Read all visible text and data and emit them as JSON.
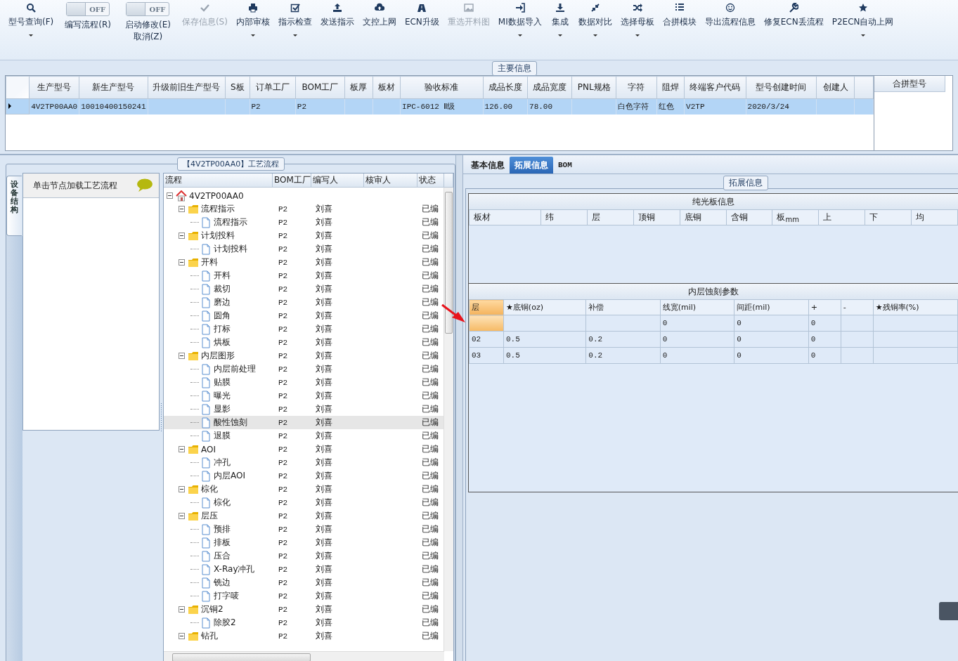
{
  "toolbar": [
    {
      "kind": "button",
      "label": "型号查询(F)",
      "dropdown": true,
      "disabled": false
    },
    {
      "kind": "toggle",
      "label": "编写流程(R)",
      "state": "OFF",
      "on": false
    },
    {
      "kind": "toggle",
      "label": "启动修改(E)\n取消(Z)",
      "state": "OFF",
      "on": false
    },
    {
      "kind": "button",
      "label": "保存信息(S)",
      "dropdown": false,
      "disabled": true
    },
    {
      "kind": "button",
      "label": "内部审核",
      "dropdown": true,
      "disabled": false
    },
    {
      "kind": "button",
      "label": "指示检查",
      "dropdown": true,
      "disabled": false
    },
    {
      "kind": "button",
      "label": "发送指示",
      "dropdown": false,
      "disabled": false
    },
    {
      "kind": "button",
      "label": "文控上网",
      "dropdown": false,
      "disabled": false
    },
    {
      "kind": "button",
      "label": "ECN升级",
      "dropdown": false,
      "disabled": false
    },
    {
      "kind": "button",
      "label": "重选开料图",
      "dropdown": false,
      "disabled": true
    },
    {
      "kind": "button",
      "label": "MI数据导入",
      "dropdown": true,
      "disabled": false
    },
    {
      "kind": "button",
      "label": "集成",
      "dropdown": true,
      "disabled": false
    },
    {
      "kind": "button",
      "label": "数据对比",
      "dropdown": true,
      "disabled": false
    },
    {
      "kind": "button",
      "label": "选择母板",
      "dropdown": true,
      "disabled": false
    },
    {
      "kind": "button",
      "label": "合拼模块",
      "dropdown": false,
      "disabled": false
    },
    {
      "kind": "button",
      "label": "导出流程信息",
      "dropdown": false,
      "disabled": false
    },
    {
      "kind": "button",
      "label": "修复ECN丢流程",
      "dropdown": false,
      "disabled": false
    },
    {
      "kind": "button",
      "label": "P2ECN自动上网",
      "dropdown": true,
      "disabled": false
    }
  ],
  "main_info": {
    "title": "主要信息",
    "columns": [
      "生产型号",
      "新生产型号",
      "升级前旧生产型号",
      "S板",
      "订单工厂",
      "BOM工厂",
      "板厚",
      "板材",
      "验收标准",
      "成品长度",
      "成品宽度",
      "PNL规格",
      "字符",
      "阻焊",
      "终端客户代码",
      "型号创建时间",
      "创建人"
    ],
    "rows": [
      {
        "selected": true,
        "cells": [
          "4V2TP00AA0",
          "10010400150241",
          "",
          "",
          "P2",
          "P2",
          "",
          "",
          "IPC-6012 Ⅱ级",
          "126.00",
          "78.00",
          "",
          "白色字符",
          "红色",
          "V2TP",
          "2020/3/24",
          ""
        ]
      }
    ],
    "side_columns": [
      "合拼型号"
    ]
  },
  "process": {
    "title": "【4V2TP00AA0】工艺流程",
    "side_tab": {
      "label": "设备结构",
      "selected": true
    },
    "hint": "单击节点加载工艺流程",
    "columns": [
      "流程",
      "BOM工厂",
      "编写人",
      "核审人",
      "状态"
    ],
    "tree": [
      {
        "kind": "root",
        "label": "4V2TP00AA0",
        "expanded": true,
        "selected": false,
        "children": [
          {
            "kind": "folder",
            "label": "流程指示",
            "bom": "P2",
            "writer": "刘喜",
            "status": "已编",
            "expanded": true,
            "selected": false,
            "children": [
              {
                "kind": "step",
                "label": "流程指示",
                "bom": "P2",
                "writer": "刘喜",
                "status": "已编",
                "selected": false
              }
            ]
          },
          {
            "kind": "folder",
            "label": "计划投料",
            "bom": "P2",
            "writer": "刘喜",
            "status": "已编",
            "expanded": true,
            "selected": false,
            "children": [
              {
                "kind": "step",
                "label": "计划投料",
                "bom": "P2",
                "writer": "刘喜",
                "status": "已编",
                "selected": false
              }
            ]
          },
          {
            "kind": "folder",
            "label": "开料",
            "bom": "P2",
            "writer": "刘喜",
            "status": "已编",
            "expanded": true,
            "selected": false,
            "children": [
              {
                "kind": "step",
                "label": "开料",
                "bom": "P2",
                "writer": "刘喜",
                "status": "已编",
                "selected": false
              },
              {
                "kind": "step",
                "label": "裁切",
                "bom": "P2",
                "writer": "刘喜",
                "status": "已编",
                "selected": false
              },
              {
                "kind": "step",
                "label": "磨边",
                "bom": "P2",
                "writer": "刘喜",
                "status": "已编",
                "selected": false
              },
              {
                "kind": "step",
                "label": "圆角",
                "bom": "P2",
                "writer": "刘喜",
                "status": "已编",
                "selected": false
              },
              {
                "kind": "step",
                "label": "打标",
                "bom": "P2",
                "writer": "刘喜",
                "status": "已编",
                "selected": false
              },
              {
                "kind": "step",
                "label": "烘板",
                "bom": "P2",
                "writer": "刘喜",
                "status": "已编",
                "selected": false
              }
            ]
          },
          {
            "kind": "folder",
            "label": "内层图形",
            "bom": "P2",
            "writer": "刘喜",
            "status": "已编",
            "expanded": true,
            "selected": false,
            "children": [
              {
                "kind": "step",
                "label": "内层前处理",
                "bom": "P2",
                "writer": "刘喜",
                "status": "已编",
                "selected": false
              },
              {
                "kind": "step",
                "label": "贴膜",
                "bom": "P2",
                "writer": "刘喜",
                "status": "已编",
                "selected": false
              },
              {
                "kind": "step",
                "label": "曝光",
                "bom": "P2",
                "writer": "刘喜",
                "status": "已编",
                "selected": false
              },
              {
                "kind": "step",
                "label": "显影",
                "bom": "P2",
                "writer": "刘喜",
                "status": "已编",
                "selected": false
              },
              {
                "kind": "step",
                "label": "酸性蚀刻",
                "bom": "P2",
                "writer": "刘喜",
                "status": "已编",
                "selected": true
              },
              {
                "kind": "step",
                "label": "退膜",
                "bom": "P2",
                "writer": "刘喜",
                "status": "已编",
                "selected": false
              }
            ]
          },
          {
            "kind": "folder",
            "label": "AOI",
            "bom": "P2",
            "writer": "刘喜",
            "status": "已编",
            "expanded": true,
            "selected": false,
            "children": [
              {
                "kind": "step",
                "label": "冲孔",
                "bom": "P2",
                "writer": "刘喜",
                "status": "已编",
                "selected": false
              },
              {
                "kind": "step",
                "label": "内层AOI",
                "bom": "P2",
                "writer": "刘喜",
                "status": "已编",
                "selected": false
              }
            ]
          },
          {
            "kind": "folder",
            "label": "棕化",
            "bom": "P2",
            "writer": "刘喜",
            "status": "已编",
            "expanded": true,
            "selected": false,
            "children": [
              {
                "kind": "step",
                "label": "棕化",
                "bom": "P2",
                "writer": "刘喜",
                "status": "已编",
                "selected": false
              }
            ]
          },
          {
            "kind": "folder",
            "label": "层压",
            "bom": "P2",
            "writer": "刘喜",
            "status": "已编",
            "expanded": true,
            "selected": false,
            "children": [
              {
                "kind": "step",
                "label": "预排",
                "bom": "P2",
                "writer": "刘喜",
                "status": "已编",
                "selected": false
              },
              {
                "kind": "step",
                "label": "排板",
                "bom": "P2",
                "writer": "刘喜",
                "status": "已编",
                "selected": false
              },
              {
                "kind": "step",
                "label": "压合",
                "bom": "P2",
                "writer": "刘喜",
                "status": "已编",
                "selected": false
              },
              {
                "kind": "step",
                "label": "X-Ray冲孔",
                "bom": "P2",
                "writer": "刘喜",
                "status": "已编",
                "selected": false
              },
              {
                "kind": "step",
                "label": "铣边",
                "bom": "P2",
                "writer": "刘喜",
                "status": "已编",
                "selected": false
              },
              {
                "kind": "step",
                "label": "打字唛",
                "bom": "P2",
                "writer": "刘喜",
                "status": "已编",
                "selected": false
              }
            ]
          },
          {
            "kind": "folder",
            "label": "沉铜2",
            "bom": "P2",
            "writer": "刘喜",
            "status": "已编",
            "expanded": true,
            "selected": false,
            "children": [
              {
                "kind": "step",
                "label": "除胶2",
                "bom": "P2",
                "writer": "刘喜",
                "status": "已编",
                "selected": false
              }
            ]
          },
          {
            "kind": "folder",
            "label": "钻孔",
            "bom": "P2",
            "writer": "刘喜",
            "status": "已编",
            "expanded": true,
            "selected": false
          }
        ]
      }
    ]
  },
  "detail": {
    "tabs": [
      {
        "label": "基本信息",
        "selected": false
      },
      {
        "label": "拓展信息",
        "selected": true
      },
      {
        "label": "BOM",
        "selected": false
      }
    ],
    "group_title": "拓展信息",
    "bare_board": {
      "title": "纯光板信息",
      "columns": [
        "板材",
        "纬",
        "层",
        "顶铜",
        "底铜",
        "含铜",
        "板$_{mm}$",
        "上",
        "下",
        "均"
      ]
    },
    "etch": {
      "title": "内层蚀刻参数",
      "columns": [
        "层",
        "★底铜(oz)",
        "补偿",
        "线宽(mil)",
        "间距(mil)",
        "+",
        "-",
        "★残铜率(%)"
      ],
      "rows": [
        {
          "selected": true,
          "cells": [
            "",
            "",
            "",
            "0",
            "0",
            "0",
            "",
            ""
          ]
        },
        {
          "selected": false,
          "cells": [
            "02",
            "0.5",
            "0.2",
            "0",
            "0",
            "0",
            "",
            ""
          ]
        },
        {
          "selected": false,
          "cells": [
            "03",
            "0.5",
            "0.2",
            "0",
            "0",
            "0",
            "",
            ""
          ]
        }
      ]
    }
  }
}
